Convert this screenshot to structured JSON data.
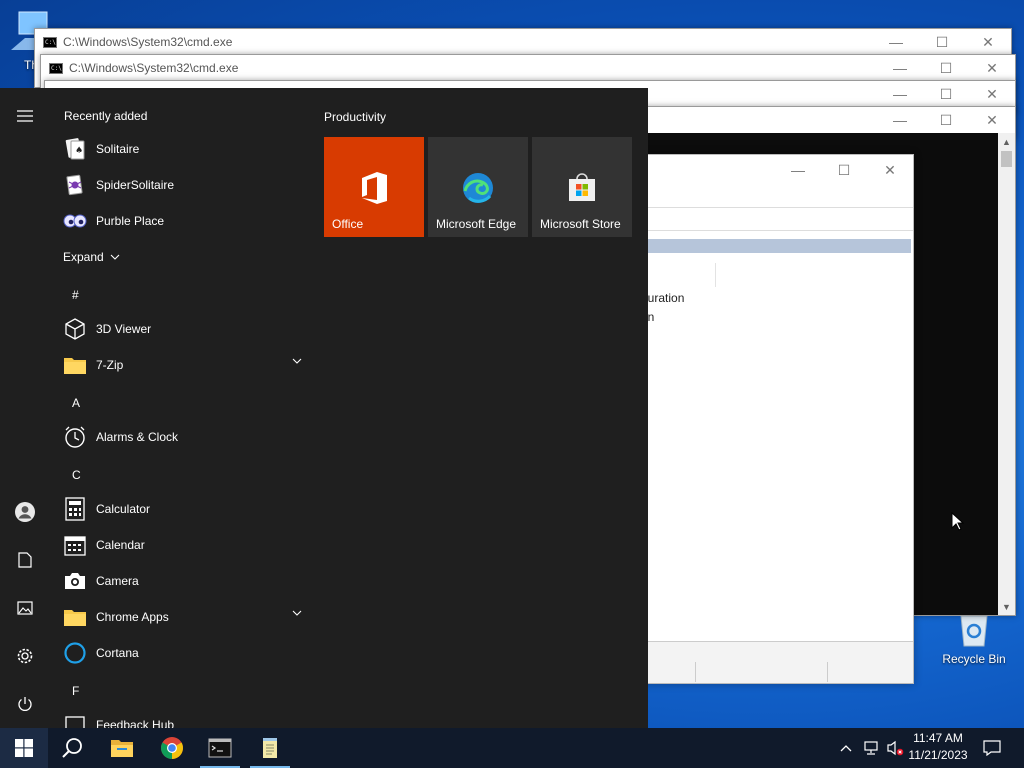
{
  "desktop": {
    "icons": [
      {
        "label": "Th",
        "icon": "this-pc-icon"
      },
      {
        "label": "Recycle Bin",
        "icon": "recycle-bin-icon"
      }
    ]
  },
  "cmd_windows": [
    {
      "title": "C:\\Windows\\System32\\cmd.exe"
    },
    {
      "title": "C:\\Windows\\System32\\cmd.exe"
    },
    {
      "title": ""
    },
    {
      "title": ""
    }
  ],
  "inner_window": {
    "lines": [
      "guration",
      "on"
    ]
  },
  "start_menu": {
    "recently_added_label": "Recently added",
    "recent_apps": [
      {
        "label": "Solitaire",
        "icon": "solitaire-icon"
      },
      {
        "label": "SpiderSolitaire",
        "icon": "spider-solitaire-icon"
      },
      {
        "label": "Purble Place",
        "icon": "purble-place-icon"
      }
    ],
    "expand_label": "Expand",
    "groups": [
      {
        "letter": "#",
        "apps": [
          {
            "label": "3D Viewer",
            "icon": "3d-viewer-icon",
            "folder": false
          },
          {
            "label": "7-Zip",
            "icon": "folder-icon",
            "folder": true
          }
        ]
      },
      {
        "letter": "A",
        "apps": [
          {
            "label": "Alarms & Clock",
            "icon": "alarm-clock-icon",
            "folder": false
          }
        ]
      },
      {
        "letter": "C",
        "apps": [
          {
            "label": "Calculator",
            "icon": "calculator-icon",
            "folder": false
          },
          {
            "label": "Calendar",
            "icon": "calendar-icon",
            "folder": false
          },
          {
            "label": "Camera",
            "icon": "camera-icon",
            "folder": false
          },
          {
            "label": "Chrome Apps",
            "icon": "folder-icon",
            "folder": true
          },
          {
            "label": "Cortana",
            "icon": "cortana-icon",
            "folder": false
          }
        ]
      },
      {
        "letter": "F",
        "apps": [
          {
            "label": "Feedback Hub",
            "icon": "feedback-hub-icon",
            "folder": false
          }
        ]
      }
    ],
    "tiles_group_title": "Productivity",
    "tiles": [
      {
        "label": "Office",
        "icon": "office-icon",
        "color": "#d83b01"
      },
      {
        "label": "Microsoft Edge",
        "icon": "edge-icon",
        "color": "#333333"
      },
      {
        "label": "Microsoft Store",
        "icon": "store-icon",
        "color": "#333333"
      }
    ],
    "rail": [
      "hamburger-menu-icon",
      "user-account-icon",
      "documents-icon",
      "pictures-icon",
      "settings-gear-icon",
      "power-icon"
    ]
  },
  "taskbar": {
    "pinned": [
      "start-windows-icon",
      "search-icon",
      "file-explorer-icon",
      "chrome-icon",
      "command-prompt-icon",
      "notepad-icon"
    ],
    "time": "11:47 AM",
    "date": "11/21/2023"
  },
  "colors": {
    "start_bg": "#1f1f1f",
    "taskbar_bg": "#101a2b",
    "accent": "#d83b01"
  }
}
